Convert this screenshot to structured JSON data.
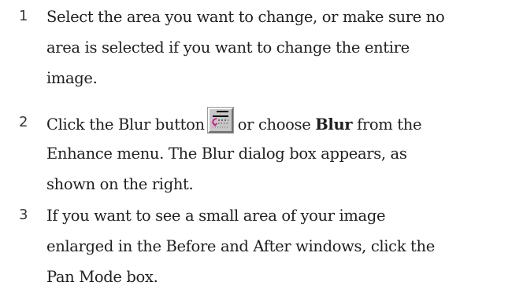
{
  "steps": [
    {
      "number": "1",
      "lines": [
        "Select the area you want to change, or make sure no",
        "area is selected if you want to change the entire",
        "image."
      ]
    },
    {
      "number": "2",
      "line1_before": "Click the Blur button",
      "line1_middle": "or choose",
      "line1_bold": "Blur",
      "line1_after": "from the",
      "lines_rest": [
        "Enhance menu. The Blur dialog box appears, as",
        "shown on the right."
      ],
      "icon": "blur-tool-icon"
    },
    {
      "number": "3",
      "lines": [
        "If you want to see a small area of your image",
        "enlarged in the Before and After windows, click the",
        "Pan Mode box."
      ]
    }
  ]
}
